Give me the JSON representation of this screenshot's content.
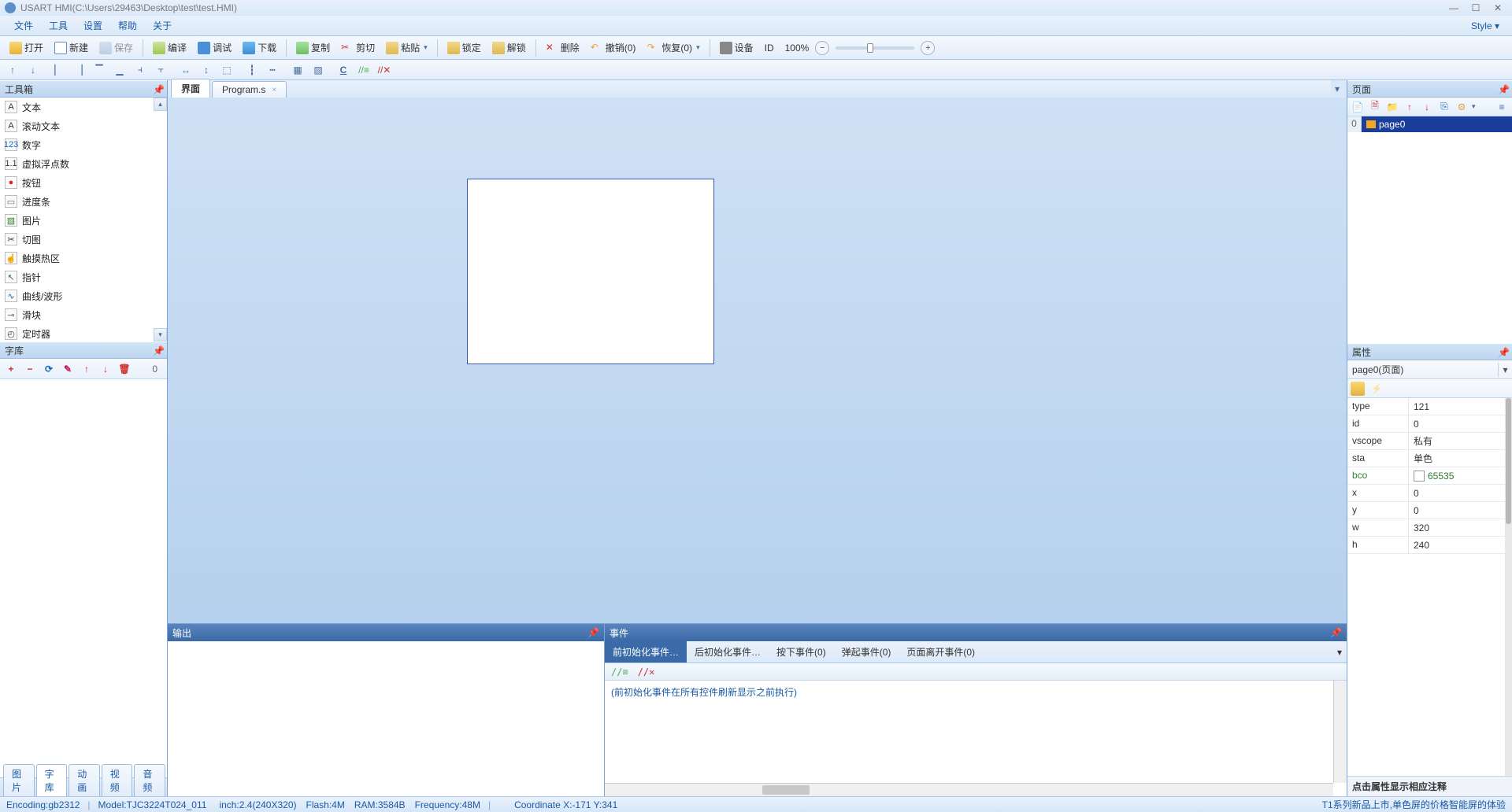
{
  "titlebar": {
    "title": "USART HMI(C:\\Users\\29463\\Desktop\\test\\test.HMI)"
  },
  "menubar": {
    "items": [
      "文件",
      "工具",
      "设置",
      "帮助",
      "关于"
    ],
    "style": "Style ▾"
  },
  "toolbar": {
    "open": "打开",
    "new": "新建",
    "save": "保存",
    "compile": "编译",
    "debug": "调试",
    "download": "下载",
    "copy": "复制",
    "cut": "剪切",
    "paste": "粘贴",
    "lock": "锁定",
    "unlock": "解锁",
    "delete": "删除",
    "undo": "撤销(0)",
    "redo": "恢复(0)",
    "device": "设备",
    "id": "ID",
    "zoom": "100%"
  },
  "panels": {
    "toolbox": "工具箱",
    "fontlib": "字库",
    "output": "输出",
    "event": "事件",
    "page": "页面",
    "property": "属性"
  },
  "toolbox": {
    "items": [
      {
        "icon": "A",
        "color": "#333",
        "label": "文本",
        "name": "text-tool"
      },
      {
        "icon": "A",
        "color": "#333",
        "label": "滚动文本",
        "name": "scroll-text-tool"
      },
      {
        "icon": "123",
        "color": "#1565c0",
        "label": "数字",
        "name": "number-tool"
      },
      {
        "icon": "1.1",
        "color": "#333",
        "label": "虚拟浮点数",
        "name": "float-tool"
      },
      {
        "icon": "●",
        "color": "#d32f2f",
        "label": "按钮",
        "name": "button-tool"
      },
      {
        "icon": "▭",
        "color": "#666",
        "label": "进度条",
        "name": "progressbar-tool"
      },
      {
        "icon": "▨",
        "color": "#2e7d32",
        "label": "图片",
        "name": "picture-tool"
      },
      {
        "icon": "✂",
        "color": "#333",
        "label": "切图",
        "name": "crop-tool"
      },
      {
        "icon": "☝",
        "color": "#999",
        "label": "触摸热区",
        "name": "hotspot-tool"
      },
      {
        "icon": "↖",
        "color": "#2e7d32",
        "label": "指针",
        "name": "pointer-tool"
      },
      {
        "icon": "∿",
        "color": "#1565c0",
        "label": "曲线/波形",
        "name": "waveform-tool"
      },
      {
        "icon": "⊸",
        "color": "#666",
        "label": "滑块",
        "name": "slider-tool"
      },
      {
        "icon": "◴",
        "color": "#333",
        "label": "定时器",
        "name": "timer-tool"
      }
    ]
  },
  "fontlib": {
    "count": "0"
  },
  "bottom_tabs": [
    "图片",
    "字库",
    "动画",
    "视频",
    "音频"
  ],
  "center_tabs": {
    "t0": "界面",
    "t1": "Program.s"
  },
  "event": {
    "tabs": [
      "前初始化事件…",
      "后初始化事件…",
      "按下事件(0)",
      "弹起事件(0)",
      "页面离开事件(0)"
    ],
    "hint": "(前初始化事件在所有控件刷新显示之前执行)"
  },
  "page": {
    "index": "0",
    "name": "page0"
  },
  "property": {
    "selector": "page0(页面)",
    "rows": [
      {
        "k": "type",
        "v": "121"
      },
      {
        "k": "id",
        "v": "0"
      },
      {
        "k": "vscope",
        "v": "私有"
      },
      {
        "k": "sta",
        "v": "单色"
      },
      {
        "k": "bco",
        "v": "65535",
        "color": true,
        "green": true
      },
      {
        "k": "x",
        "v": "0"
      },
      {
        "k": "y",
        "v": "0"
      },
      {
        "k": "w",
        "v": "320"
      },
      {
        "k": "h",
        "v": "240"
      }
    ],
    "hint": "点击属性显示相应注释"
  },
  "statusbar": {
    "encoding": "Encoding:gb2312",
    "model": "Model:TJC3224T024_011",
    "inch": "inch:2.4(240X320)",
    "flash": "Flash:4M",
    "ram": "RAM:3584B",
    "freq": "Frequency:48M",
    "coord": "Coordinate X:-171   Y:341",
    "promo": "T1系列新品上市,单色屏的价格智能屏的体验"
  }
}
